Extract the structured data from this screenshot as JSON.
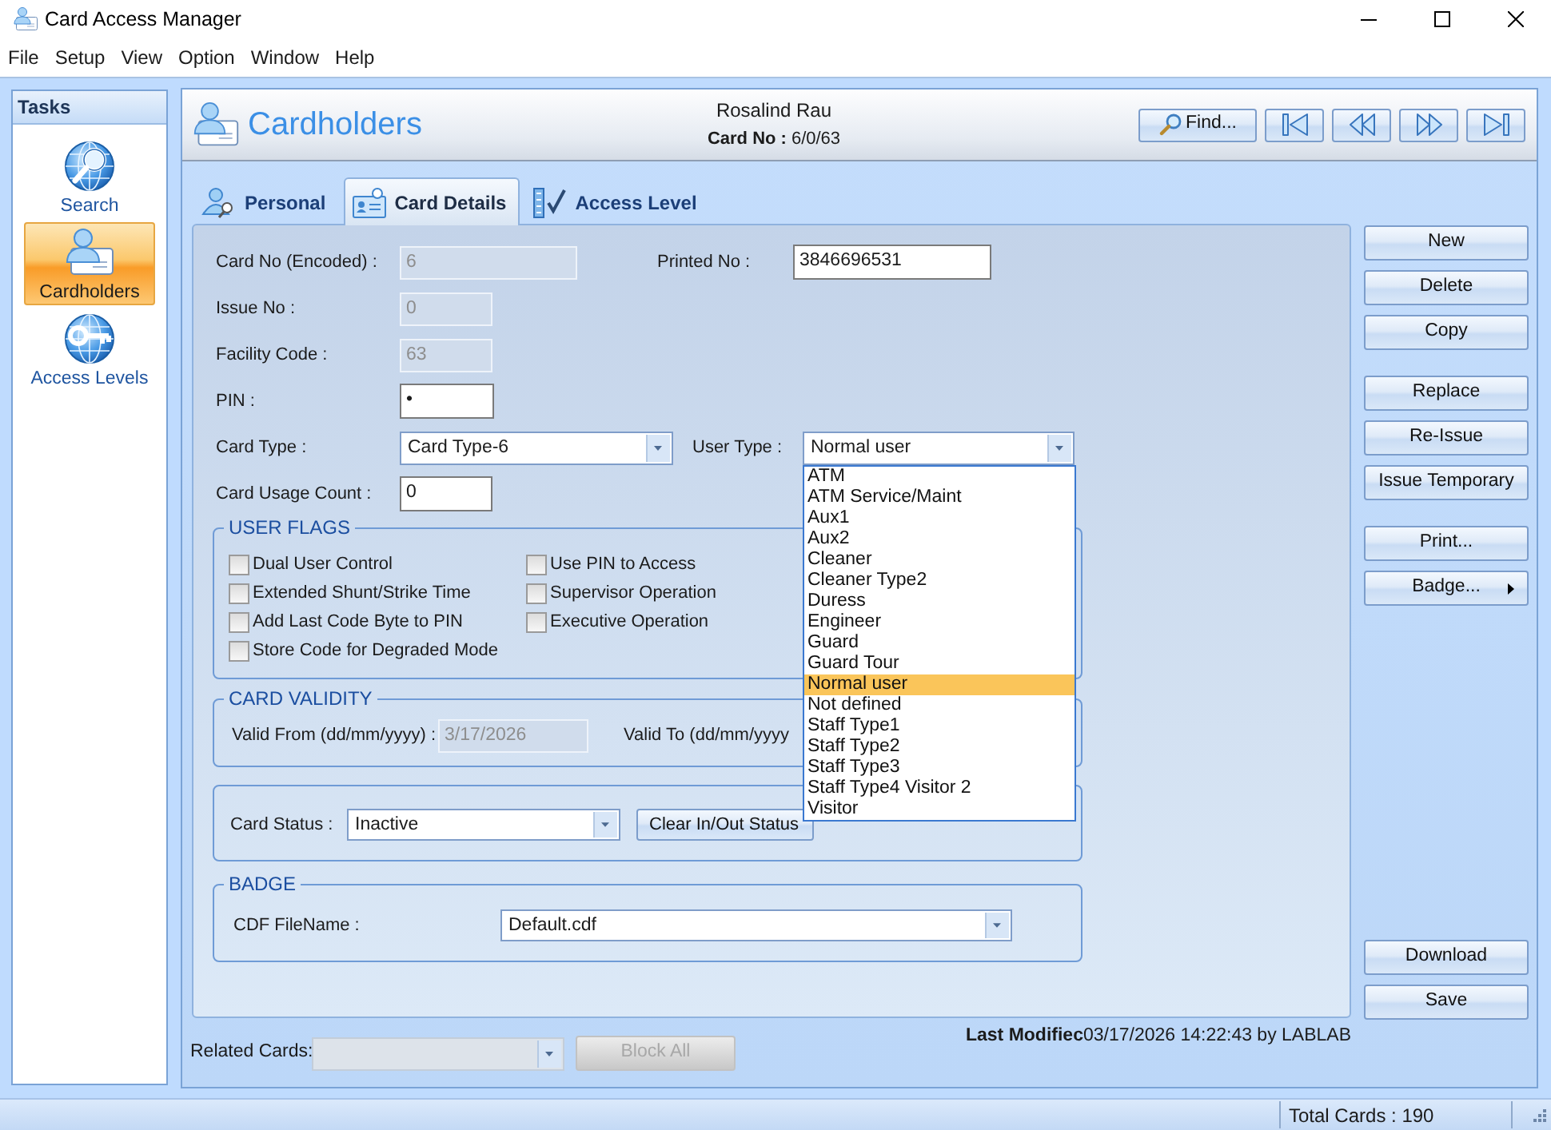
{
  "window": {
    "title": "Card Access Manager"
  },
  "menu": [
    "File",
    "Setup",
    "View",
    "Option",
    "Window",
    "Help"
  ],
  "tasks": {
    "title": "Tasks",
    "items": [
      {
        "label": "Search",
        "kind": "search",
        "selected": false
      },
      {
        "label": "Cardholders",
        "kind": "cardholder",
        "selected": true
      },
      {
        "label": "Access Levels",
        "kind": "key",
        "selected": false
      }
    ]
  },
  "header": {
    "title": "Cardholders",
    "name": "Rosalind Rau",
    "card_no_label": "Card No :",
    "card_no": "6/0/63",
    "find_button": "Find...",
    "nav_buttons": [
      {
        "kind": "first"
      },
      {
        "kind": "previous"
      },
      {
        "kind": "next"
      },
      {
        "kind": "last"
      }
    ]
  },
  "tabs": [
    {
      "label": "Personal",
      "kind": "person",
      "selected": false
    },
    {
      "label": "Card Details",
      "kind": "card",
      "selected": true
    },
    {
      "label": "Access Level",
      "kind": "list",
      "selected": false
    }
  ],
  "card_details": {
    "card_no": {
      "label": "Card No (Encoded) :",
      "value": "6",
      "disabled": true
    },
    "printed_no": {
      "label": "Printed No :",
      "value": "3846696531",
      "disabled": false
    },
    "issue_no": {
      "label": "Issue No :",
      "value": "0",
      "disabled": true
    },
    "facility_code": {
      "label": "Facility Code :",
      "value": "63",
      "disabled": true
    },
    "pin": {
      "label": "PIN :",
      "value": "•",
      "disabled": false
    },
    "card_type": {
      "label": "Card Type :",
      "value": "Card Type-6",
      "disabled": false
    },
    "user_type": {
      "label": "User Type :",
      "value": "Normal user",
      "disabled": false,
      "expanded": true,
      "options": [
        {
          "label": "ATM",
          "selected": false
        },
        {
          "label": "ATM Service/Maint",
          "selected": false
        },
        {
          "label": "Aux1",
          "selected": false
        },
        {
          "label": "Aux2",
          "selected": false
        },
        {
          "label": "Cleaner",
          "selected": false
        },
        {
          "label": "Cleaner Type2",
          "selected": false
        },
        {
          "label": "Duress",
          "selected": false
        },
        {
          "label": "Engineer",
          "selected": false
        },
        {
          "label": "Guard",
          "selected": false
        },
        {
          "label": "Guard Tour",
          "selected": false
        },
        {
          "label": "Normal user",
          "selected": true
        },
        {
          "label": "Not defined",
          "selected": false
        },
        {
          "label": "Staff Type1",
          "selected": false
        },
        {
          "label": "Staff Type2",
          "selected": false
        },
        {
          "label": "Staff Type3",
          "selected": false
        },
        {
          "label": "Staff Type4 Visitor 2",
          "selected": false
        },
        {
          "label": "Visitor",
          "selected": false
        }
      ]
    },
    "card_usage_count": {
      "label": "Card Usage Count :",
      "value": "0",
      "disabled": false
    }
  },
  "user_flags": {
    "title": "USER FLAGS",
    "columns": [
      [
        {
          "label": "Dual User Control",
          "checked": false
        },
        {
          "label": "Extended Shunt/Strike Time",
          "checked": false
        },
        {
          "label": "Add Last Code Byte to PIN",
          "checked": false
        },
        {
          "label": "Store Code for Degraded Mode",
          "checked": false
        }
      ],
      [
        {
          "label": "Use PIN to Access",
          "checked": false
        },
        {
          "label": "Supervisor Operation",
          "checked": false
        },
        {
          "label": "Executive Operation",
          "checked": false
        }
      ]
    ]
  },
  "card_validity": {
    "title": "CARD VALIDITY",
    "valid_from": {
      "label": "Valid From (dd/mm/yyyy) :",
      "value": "3/17/2026",
      "disabled": true
    },
    "valid_to_label": "Valid To (dd/mm/yyyy"
  },
  "card_status": {
    "label": "Card Status :",
    "value": "Inactive",
    "disabled": false,
    "button": "Clear In/Out Status"
  },
  "badge": {
    "title": "BADGE",
    "label": "CDF FileName :",
    "value": "Default.cdf",
    "disabled": false
  },
  "side_buttons": [
    {
      "buttons": [
        {
          "label": "New",
          "kind": "plain"
        },
        {
          "label": "Delete",
          "kind": "plain"
        },
        {
          "label": "Copy",
          "kind": "plain"
        }
      ]
    },
    {
      "buttons": [
        {
          "label": "Replace",
          "kind": "plain"
        },
        {
          "label": "Re-Issue",
          "kind": "plain"
        },
        {
          "label": "Issue Temporary",
          "kind": "plain"
        }
      ]
    },
    {
      "buttons": [
        {
          "label": "Print...",
          "kind": "plain"
        },
        {
          "label": "Badge...",
          "kind": "submenu"
        }
      ]
    },
    {
      "buttons": [
        {
          "label": "Download",
          "kind": "plain"
        },
        {
          "label": "Save",
          "kind": "plain"
        }
      ]
    }
  ],
  "last_modified": {
    "label": "Last Modifiec",
    "value": "03/17/2026 14:22:43 by LABLAB"
  },
  "related_cards": {
    "label": "Related Cards:",
    "disabled": true,
    "button": "Block All",
    "button_disabled": true
  },
  "status_bar": {
    "total_cards": "Total Cards : 190"
  }
}
